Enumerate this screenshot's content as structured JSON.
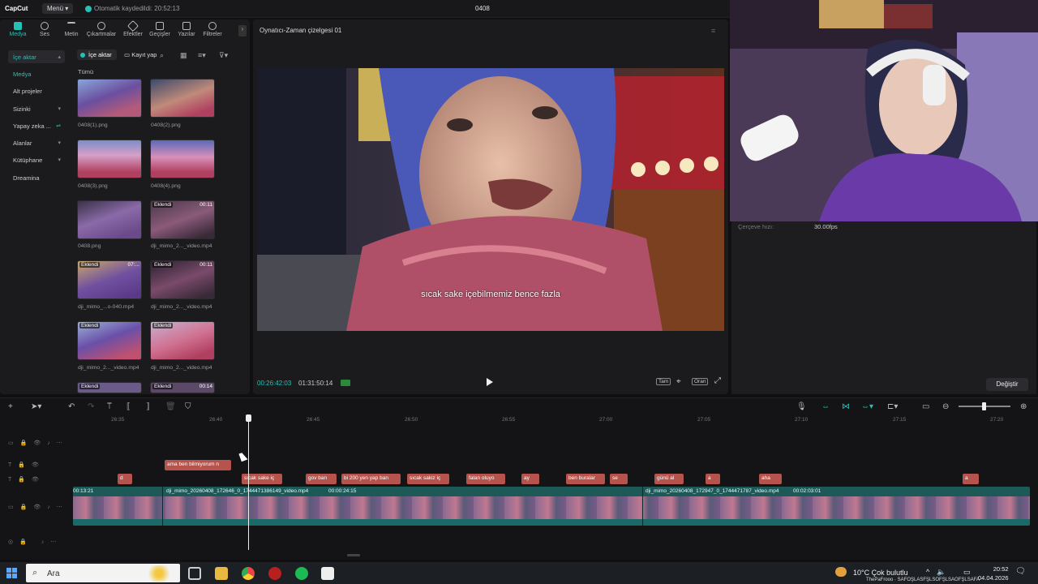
{
  "titlebar": {
    "app_name": "CapCut",
    "menu_label": "Menü",
    "autosave_text": "Otomatik kaydedildi: 20:52:13",
    "project_title": "0408"
  },
  "toolbar": {
    "tools": [
      {
        "label": "Medya",
        "icon": "media-icon"
      },
      {
        "label": "Ses",
        "icon": "audio-icon"
      },
      {
        "label": "Metin",
        "icon": "text-icon"
      },
      {
        "label": "Çıkartmalar",
        "icon": "sticker-icon"
      },
      {
        "label": "Efektler",
        "icon": "effects-icon"
      },
      {
        "label": "Geçişler",
        "icon": "transitions-icon"
      },
      {
        "label": "Yazılar",
        "icon": "captions-icon"
      },
      {
        "label": "Filtreler",
        "icon": "filters-icon"
      }
    ]
  },
  "sidebar": {
    "items": [
      {
        "label": "İçe aktar"
      },
      {
        "label": "Medya"
      },
      {
        "label": "Alt projeler"
      },
      {
        "label": "Sizinki"
      },
      {
        "label": "Yapay zeka ..."
      },
      {
        "label": "Alanlar"
      },
      {
        "label": "Kütüphane"
      },
      {
        "label": "Dreamina"
      }
    ]
  },
  "media": {
    "import_label": "İçe aktar",
    "record_label": "Kayıt yap",
    "all_label": "Tümü",
    "items": [
      {
        "name": "0408(1).png",
        "tag": "",
        "duration": ""
      },
      {
        "name": "0408(2).png",
        "tag": "",
        "duration": ""
      },
      {
        "name": "0408(3).png",
        "tag": "",
        "duration": ""
      },
      {
        "name": "0408(4).png",
        "tag": "",
        "duration": ""
      },
      {
        "name": "0408.png",
        "tag": "",
        "duration": ""
      },
      {
        "name": "dji_mimo_2..._video.mp4",
        "tag": "Eklendi",
        "duration": "00:11"
      },
      {
        "name": "dji_mimo_...o-040.mp4",
        "tag": "Eklendi",
        "duration": "07:..."
      },
      {
        "name": "dji_mimo_2..._video.mp4",
        "tag": "Eklendi",
        "duration": "00:11"
      },
      {
        "name": "dji_mimo_2..._video.mp4",
        "tag": "Eklendi",
        "duration": ""
      },
      {
        "name": "dji_mimo_2..._video.mp4",
        "tag": "Eklendi",
        "duration": ""
      },
      {
        "name": "",
        "tag": "Eklendi",
        "duration": ""
      },
      {
        "name": "",
        "tag": "Eklendi",
        "duration": "00:14"
      }
    ]
  },
  "player": {
    "title": "Oynatıcı-Zaman çizelgesi 01",
    "subtitle": "sıcak sake içebilmemiz bence fazla",
    "time_current": "00:26:42:03",
    "time_total": "01:31:50:14",
    "btn_full": "Tam",
    "btn_ratio": "Oran"
  },
  "details": {
    "fps_label": "Çerçeve hızı:",
    "fps_value": "30.00fps",
    "change_label": "Değiştir"
  },
  "timeline": {
    "ruler": [
      "26:35",
      "26:40",
      "26:45",
      "26:50",
      "26:55",
      "27:00",
      "27:05",
      "27:10",
      "27:15",
      "27:20"
    ],
    "top_clip": "ama ben bilmiyorum n",
    "text_clips": [
      "d",
      "sıcak sake iç",
      "gov ban",
      "bi 200 yen yap ban",
      "sıcak sakiz iç",
      "falan oluyo",
      "ay",
      "ben buralar",
      "se",
      "günü al",
      "a",
      "aha",
      "a"
    ],
    "video_clip_start": "00:13:21",
    "video_clip_1": "dji_mimo_20260408_172646_0_1744471386149_video.mp4",
    "video_clip_1_dur": "00:00:24:15",
    "video_clip_2": "dji_mimo_20260408_172947_0_1744471787_video.mp4",
    "video_clip_2_dur": "00:02:03:01"
  },
  "taskbar": {
    "search_placeholder": "Ara",
    "weather": "10°C  Çok bulutlu",
    "time": "20:52",
    "date": "04.04.2026",
    "ticker": "ThePaFrooo · SAFOŞLASFŞLSOFŞLSAOFŞLSAFA"
  },
  "colors": {
    "accent": "#22c3b5",
    "text_clip": "#b6534c",
    "video_track": "#1d5957"
  }
}
